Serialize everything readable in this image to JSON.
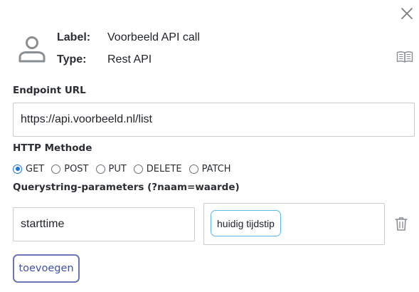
{
  "header": {
    "label_key": "Label:",
    "label_value": "Voorbeeld API call",
    "type_key": "Type:",
    "type_value": "Rest API"
  },
  "icons": {
    "close": "close-icon",
    "avatar": "user-icon",
    "docs": "book-icon",
    "delete": "trash-icon"
  },
  "endpoint": {
    "label": "Endpoint URL",
    "value": "https://api.voorbeeld.nl/list"
  },
  "http_method": {
    "label": "HTTP Methode",
    "options": [
      "GET",
      "POST",
      "PUT",
      "DELETE",
      "PATCH"
    ],
    "selected": "GET"
  },
  "querystring": {
    "label": "Querystring-parameters (?naam=waarde)",
    "params": [
      {
        "name": "starttime",
        "value_chip": "huidig tijdstip"
      }
    ]
  },
  "actions": {
    "add_label": "toevoegen"
  },
  "colors": {
    "accent": "#1a73d9",
    "chip_border": "#5eb7e0",
    "add_button": "#3f51a8",
    "icon_gray": "#8a8f94"
  }
}
